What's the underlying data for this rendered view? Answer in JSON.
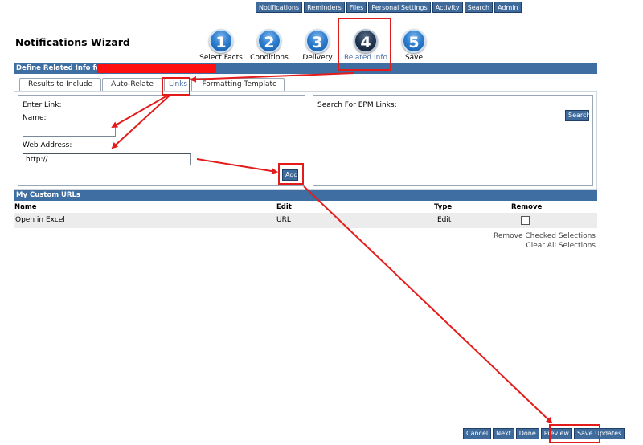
{
  "topnav": [
    "Notifications",
    "Reminders",
    "Files",
    "Personal Settings",
    "Activity",
    "Search",
    "Admin"
  ],
  "wizard": {
    "title": "Notifications Wizard",
    "steps": [
      {
        "num": "1",
        "label": "Select Facts"
      },
      {
        "num": "2",
        "label": "Conditions"
      },
      {
        "num": "3",
        "label": "Delivery"
      },
      {
        "num": "4",
        "label": "Related Info"
      },
      {
        "num": "5",
        "label": "Save"
      }
    ],
    "active_step": 4
  },
  "define_bar": {
    "title": "Define Related Info for"
  },
  "tabs": [
    "Results to Include",
    "Auto-Relate",
    "Links",
    "Formatting Template"
  ],
  "active_tab": "Links",
  "link_form": {
    "enter_link": "Enter Link:",
    "name_label": "Name:",
    "name_value": "",
    "web_address_label": "Web Address:",
    "web_address_value": "http://",
    "add_button": "Add"
  },
  "epm_search": {
    "label": "Search For EPM Links:",
    "search_button": "Search"
  },
  "custom_urls": {
    "title": "My Custom URLs",
    "columns": [
      "Name",
      "Edit",
      "Type",
      "Remove"
    ],
    "rows": [
      {
        "name": "Open in Excel",
        "edit": "URL",
        "type": "Edit",
        "remove": false
      }
    ],
    "remove_checked": "Remove Checked Selections",
    "clear_all": "Clear All Selections"
  },
  "bottom_buttons": [
    "Cancel",
    "Next",
    "Done",
    "Preview",
    "Save Updates"
  ],
  "colors": {
    "nav_blue": "#3e6b9c",
    "section_bar": "#3f6ea3",
    "annotation_red": "#e41b1b",
    "row_gray": "#ececec"
  }
}
